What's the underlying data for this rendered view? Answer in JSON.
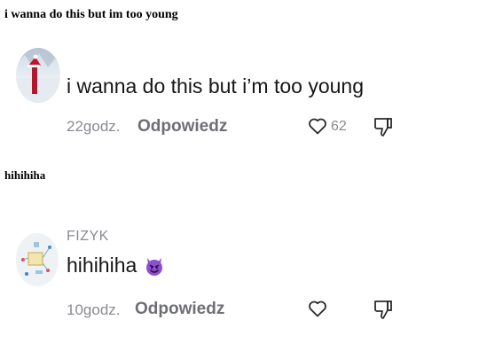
{
  "captions": {
    "first": "i wanna do this but im too young",
    "second": "hihihiha"
  },
  "comments": [
    {
      "text": "i wanna do this but i’m too young",
      "time": "22godz.",
      "reply_label": "Odpowiedz",
      "like_count": "62"
    },
    {
      "username": "FIZYK",
      "text": "hihihiha",
      "emoji": "😈",
      "time": "10godz.",
      "reply_label": "Odpowiedz"
    }
  ],
  "colors": {
    "muted": "#8a8b91",
    "reply": "#6e6f75",
    "text": "#161616",
    "emoji_purple": "#7b3fbf"
  },
  "icons": [
    "heart-icon",
    "dislike-icon"
  ]
}
